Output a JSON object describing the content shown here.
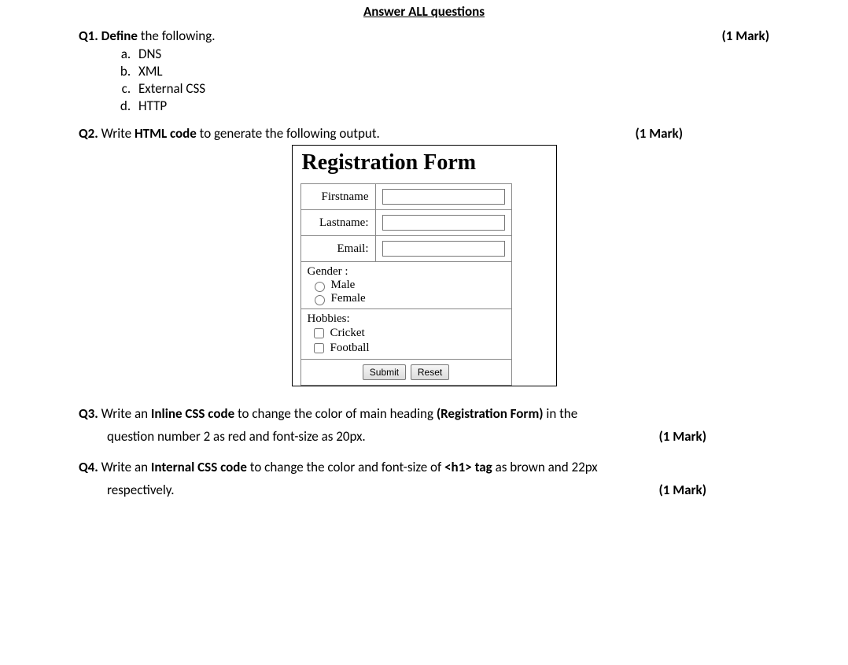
{
  "header": {
    "instruction": "Answer ALL questions"
  },
  "q1": {
    "num": "Q1.",
    "verb": "Define",
    "rest": " the following.",
    "mark": "(1 Mark)",
    "items": [
      "DNS",
      "XML",
      "External CSS",
      "HTTP"
    ]
  },
  "q2": {
    "num": "Q2.",
    "pre": " Write ",
    "bold": "HTML code",
    "post": " to generate the following output.",
    "mark": "(1 Mark)",
    "form": {
      "heading": "Registration Form",
      "firstname_label": "Firstname",
      "lastname_label": "Lastname:",
      "email_label": "Email:",
      "gender_label": "Gender :",
      "gender_male": "Male",
      "gender_female": "Female",
      "hobbies_label": "Hobbies:",
      "hobby_cricket": "Cricket",
      "hobby_football": "Football",
      "submit": "Submit",
      "reset": "Reset"
    }
  },
  "q3": {
    "num": "Q3.",
    "pre": " Write an ",
    "bold1": "Inline CSS code",
    "mid": " to change the color of main heading ",
    "bold2": "(Registration Form)",
    "post1": " in the",
    "line2": "question number 2 as red and font-size as 20px.",
    "mark": "(1 Mark)"
  },
  "q4": {
    "num": "Q4.",
    "pre": " Write an ",
    "bold1": "Internal CSS code",
    "mid": " to change the color and font-size of ",
    "bold2": "<h1> tag",
    "post1": " as brown and 22px",
    "line2": "respectively.",
    "mark": "(1 Mark)"
  }
}
